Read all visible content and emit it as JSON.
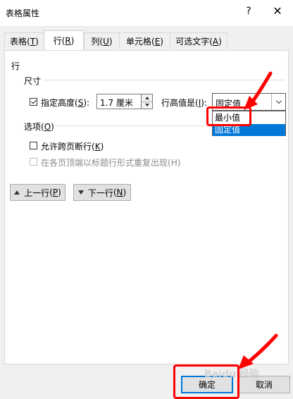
{
  "window": {
    "title": "表格属性",
    "help": "?",
    "close": "✕"
  },
  "tabs": [
    {
      "label": "表格",
      "key": "T",
      "active": false
    },
    {
      "label": "行",
      "key": "R",
      "active": true
    },
    {
      "label": "列",
      "key": "U",
      "active": false
    },
    {
      "label": "单元格",
      "key": "E",
      "active": false
    },
    {
      "label": "可选文字",
      "key": "A",
      "active": false
    }
  ],
  "row_section": {
    "heading": "行",
    "size_label": "尺寸",
    "specify_height": {
      "label": "指定高度",
      "key": "S",
      "checked": true,
      "value": "1.7 厘米"
    },
    "height_rule": {
      "label": "行高值是",
      "key": "I",
      "value": "固定值",
      "options": [
        "最小值",
        "固定值"
      ],
      "highlighted_option": "固定值"
    },
    "options_label": "选项",
    "options_key": "O",
    "allow_break": {
      "label": "允许跨页断行",
      "key": "K",
      "checked": false
    },
    "repeat_header": {
      "label": "在各页顶端以标题行形式重复出现",
      "key": "H",
      "checked": false,
      "enabled": false
    }
  },
  "nav": {
    "prev_row": {
      "label": "上一行",
      "key": "P"
    },
    "next_row": {
      "label": "下一行",
      "key": "N"
    }
  },
  "footer": {
    "ok": "确定",
    "cancel": "取消"
  },
  "watermark": "Baidu 经验",
  "colors": {
    "annotation": "#ff0000",
    "selection": "#0078d7"
  }
}
